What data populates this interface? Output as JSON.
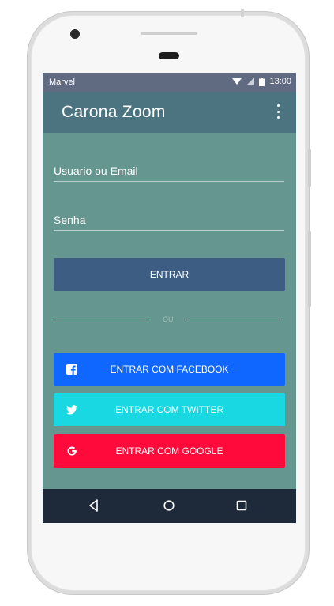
{
  "status_bar": {
    "carrier": "Marvel",
    "time": "13:00"
  },
  "app_bar": {
    "title": "Carona Zoom"
  },
  "login": {
    "username_placeholder": "Usuario ou Email",
    "password_placeholder": "Senha",
    "submit_label": "ENTRAR",
    "divider_text": "OU"
  },
  "social": {
    "facebook_label": "ENTRAR COM FACEBOOK",
    "twitter_label": "ENTRAR COM TWITTER",
    "google_label": "ENTRAR COM GOOGLE"
  },
  "icons": {
    "wifi": "wifi-icon",
    "signal": "signal-icon",
    "battery": "battery-icon",
    "more": "more-vert-icon",
    "facebook": "facebook-icon",
    "twitter": "twitter-icon",
    "google": "google-icon",
    "back": "back-icon",
    "home": "home-icon",
    "recents": "recents-icon"
  },
  "colors": {
    "screen_bg": "#669690",
    "app_bar": "#4c7480",
    "status_bar": "#606a80",
    "entrar": "#3e5d82",
    "facebook": "#0f67ff",
    "twitter": "#1ad8e2",
    "google": "#ff0a3a",
    "nav_bar": "#1e2a39"
  }
}
